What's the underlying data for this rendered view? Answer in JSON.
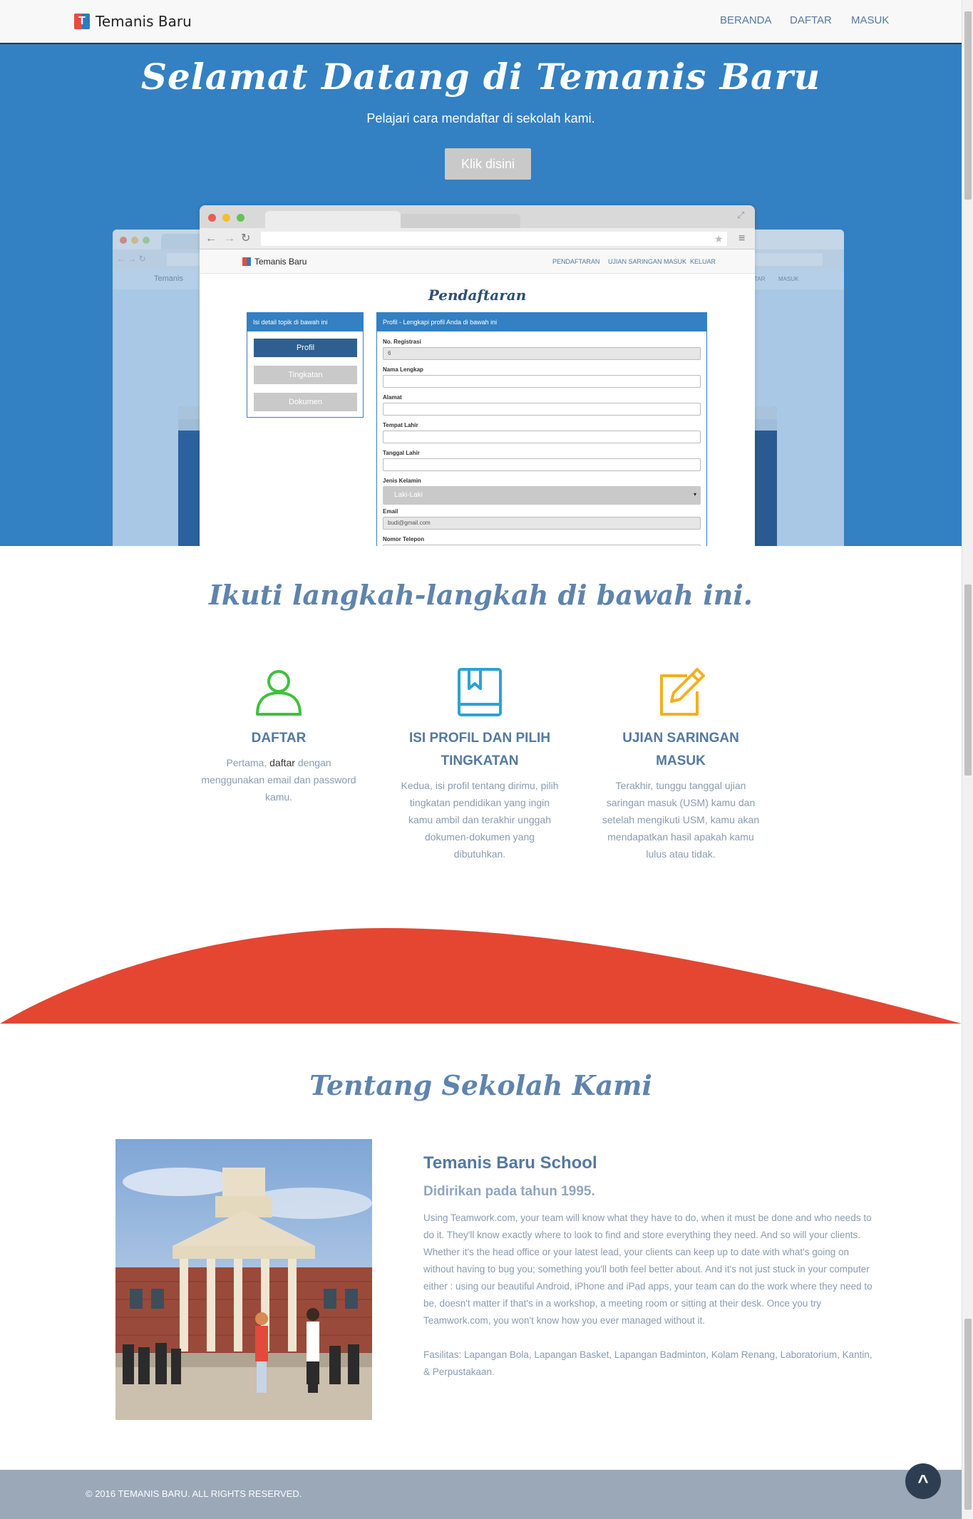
{
  "navbar": {
    "brand": "Temanis Baru",
    "links": [
      "BERANDA",
      "DAFTAR",
      "MASUK"
    ]
  },
  "hero": {
    "title": "Selamat Datang di Temanis Baru",
    "subtitle": "Pelajari cara mendaftar di sekolah kami.",
    "button": "Klik disini"
  },
  "preview": {
    "brand": "Temanis Baru",
    "back_brand": "Temanis",
    "nav_links": [
      "PENDAFTARAN",
      "UJIAN SARINGAN MASUK",
      "KELUAR"
    ],
    "back_nav_links": [
      "TAR",
      "MASUK"
    ],
    "title": "Pendaftaran",
    "left_panel_head": "Isi detail topik di bawah ini",
    "left_buttons": [
      "Profil",
      "Tingkatan",
      "Dokumen"
    ],
    "right_panel_head": "Profil - Lengkapi profil Anda di bawah ini",
    "fields": [
      {
        "label": "No. Registrasi",
        "value": "6"
      },
      {
        "label": "Nama Lengkap",
        "value": ""
      },
      {
        "label": "Alamat",
        "value": ""
      },
      {
        "label": "Tempat Lahir",
        "value": ""
      },
      {
        "label": "Tanggal Lahir",
        "value": ""
      },
      {
        "label": "Jenis Kelamin",
        "value": "Laki-Laki"
      },
      {
        "label": "Email",
        "value": "budi@gmail.com"
      },
      {
        "label": "Nomor Telepon",
        "value": ""
      }
    ]
  },
  "steps": {
    "heading": "Ikuti langkah-langkah di bawah ini.",
    "items": [
      {
        "icon": "user-icon",
        "title": "DAFTAR",
        "text_before": "Pertama, ",
        "text_link": "daftar",
        "text_after": " dengan menggunakan email dan password kamu."
      },
      {
        "icon": "book-icon",
        "title": "ISI PROFIL DAN PILIH TINGKATAN",
        "text": "Kedua, isi profil tentang dirimu, pilih tingkatan pendidikan yang ingin kamu ambil dan terakhir unggah dokumen-dokumen yang dibutuhkan."
      },
      {
        "icon": "edit-icon",
        "title": "UJIAN SARINGAN MASUK",
        "text": "Terakhir, tunggu tanggal ujian saringan masuk (USM) kamu dan setelah mengikuti USM, kamu akan mendapatkan hasil apakah kamu lulus atau tidak."
      }
    ]
  },
  "about": {
    "heading": "Tentang Sekolah Kami",
    "school_name": "Temanis Baru School",
    "founded": "Didirikan pada tahun 1995.",
    "description": "Using Teamwork.com, your team will know what they have to do, when it must be done and who needs to do it. They'll know exactly where to look to find and store everything they need. And so will your clients. Whether it's the head office or your latest lead, your clients can keep up to date with what's going on without having to bug you; something you'll both feel better about. And it's not just stuck in your computer either : using our beautiful Android, iPhone and iPad apps, your team can do the work where they need to be, doesn't matter if that's in a workshop, a meeting room or sitting at their desk. Once you try Teamwork.com, you won't know how you ever managed without it.",
    "facilities": "Fasilitas: Lapangan Bola, Lapangan Basket, Lapangan Badminton, Kolam Renang, Laboratorium, Kantin, & Perpustakaan."
  },
  "footer": {
    "copyright": "© 2016 TEMANIS BARU. ALL RIGHTS RESERVED.",
    "to_top": "^"
  },
  "colors": {
    "hero_bg": "#3380c2",
    "accent_red": "#e44632",
    "icon_green": "#3fc13a",
    "icon_blue": "#2aa3d6",
    "icon_yellow": "#f2b01e",
    "footer_bg": "#9aa8b8"
  }
}
